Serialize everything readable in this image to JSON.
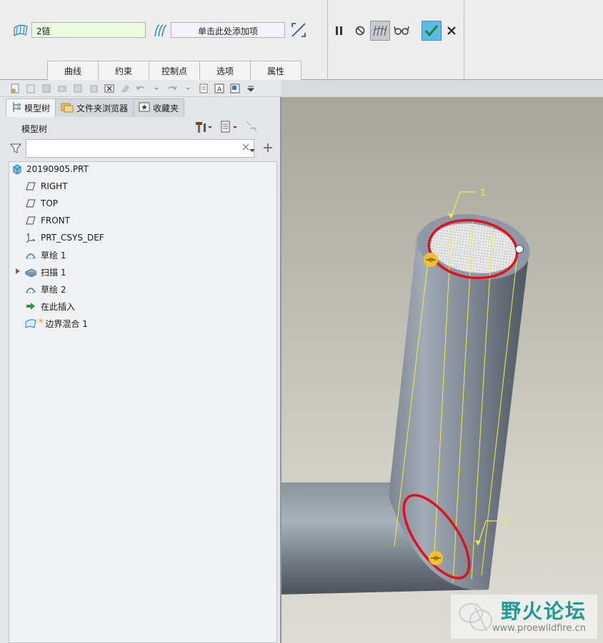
{
  "dashboard": {
    "chain_value": "2链",
    "add_item_text": "单击此处添加项",
    "tabs": [
      "曲线",
      "约束",
      "控制点",
      "选项",
      "属性"
    ],
    "accent_color": "#5db9ea",
    "icons": [
      "boundary-blend-icon",
      "curve-set-icon",
      "toggle-direction-icon",
      "pause-icon",
      "no-preview-icon",
      "verify-mode-icon",
      "glasses-preview-icon",
      "ok-check-icon",
      "cancel-x-icon"
    ]
  },
  "navigator": {
    "tabs": [
      "模型树",
      "文件夹浏览器",
      "收藏夹"
    ],
    "header": "模型树",
    "search_value": "",
    "items": [
      {
        "label": "20190905.PRT",
        "icon": "part-icon"
      },
      {
        "label": "RIGHT",
        "icon": "datum-plane-icon"
      },
      {
        "label": "TOP",
        "icon": "datum-plane-icon"
      },
      {
        "label": "FRONT",
        "icon": "datum-plane-icon"
      },
      {
        "label": "PRT_CSYS_DEF",
        "icon": "csys-icon"
      },
      {
        "label": "草绘 1",
        "icon": "sketch-icon"
      },
      {
        "label": "扫描 1",
        "icon": "sweep-icon"
      },
      {
        "label": "草绘 2",
        "icon": "sketch-icon"
      },
      {
        "label": "在此插入",
        "icon": "insert-arrow-icon"
      },
      {
        "label": "边界混合 1",
        "icon": "boundary-blend-icon"
      }
    ]
  },
  "graphics": {
    "callouts": [
      "1",
      "2"
    ],
    "chain_color": "#e0101e",
    "guide_color": "#f4ee3a"
  },
  "watermark": {
    "title": "野火论坛",
    "url": "www.proewildfire.cn"
  }
}
